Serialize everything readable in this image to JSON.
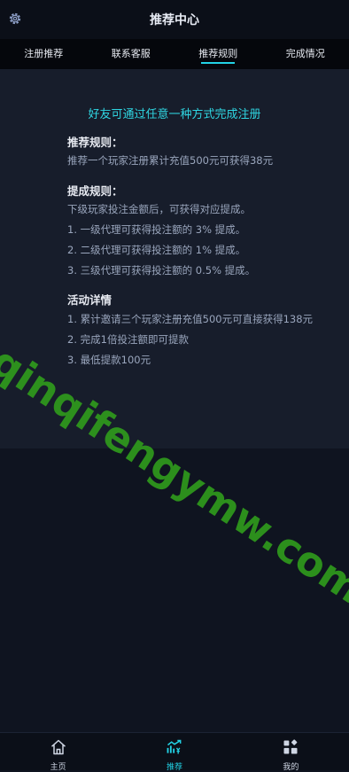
{
  "header": {
    "title": "推荐中心",
    "settings_icon": "gear-icon"
  },
  "tabs": [
    {
      "label": "注册推荐",
      "active": false
    },
    {
      "label": "联系客服",
      "active": false
    },
    {
      "label": "推荐规则",
      "active": true
    },
    {
      "label": "完成情况",
      "active": false
    }
  ],
  "content": {
    "headline": "好友可通过任意一种方式完成注册",
    "recommend": {
      "title": "推荐规则：",
      "lines": [
        "推荐一个玩家注册累计充值500元可获得38元"
      ]
    },
    "commission": {
      "title": "提成规则：",
      "lines": [
        "下级玩家投注金额后，可获得对应提成。",
        "1. 一级代理可获得投注额的 3% 提成。",
        "2. 二级代理可获得投注额的 1% 提成。",
        "3. 三级代理可获得投注额的 0.5% 提成。"
      ]
    },
    "activity": {
      "title": "活动详情",
      "lines": [
        "1. 累计邀请三个玩家注册充值500元可直接获得138元",
        "2. 完成1倍投注额即可提款",
        "3. 最低提款100元"
      ]
    }
  },
  "watermark": "qinqifengymw.com",
  "bottom_nav": [
    {
      "label": "主页",
      "icon": "home-icon",
      "active": false
    },
    {
      "label": "推荐",
      "icon": "chart-icon",
      "active": true
    },
    {
      "label": "我的",
      "icon": "grid-icon",
      "active": false
    }
  ],
  "colors": {
    "accent": "#22d3e6",
    "background": "#0f1420",
    "panel": "#171d2b",
    "watermark": "#2f9a1c"
  }
}
